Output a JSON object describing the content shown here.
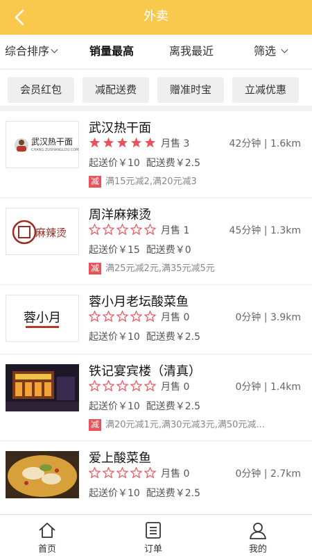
{
  "header": {
    "title": "外卖"
  },
  "sort": {
    "items": [
      {
        "label": "综合排序",
        "has_caret": true
      },
      {
        "label": "销量最高",
        "active": true
      },
      {
        "label": "离我最近"
      },
      {
        "label": "筛选",
        "has_caret": true
      }
    ]
  },
  "chips": [
    "会员红包",
    "减配送费",
    "赠准时宝",
    "立减优惠"
  ],
  "shops": [
    {
      "name": "武汉热干面",
      "rating": 5,
      "sales": "月售 3",
      "distance": "42分钟 | 1.6km",
      "min_price": "起送价￥10",
      "delivery_fee": "配送费￥2.5",
      "promo_badge": "减",
      "promo": "满15元减2,满20元减3",
      "logo_text": "武汉热干面",
      "logo_subtext": "CHANG ZUSHANGLOU.COM"
    },
    {
      "name": "周洋麻辣烫",
      "rating": 0,
      "sales": "月售 1",
      "distance": "45分钟 | 1.3km",
      "min_price": "起送价￥15",
      "delivery_fee": "配送费￥0",
      "promo_badge": "减",
      "promo": "满25元减2元,满35元减5元",
      "logo_text": "麻辣烫"
    },
    {
      "name": "蓉小月老坛酸菜鱼",
      "rating": 0,
      "sales": "月售 0",
      "distance": "0分钟 | 3.9km",
      "min_price": "起送价￥10",
      "delivery_fee": "配送费￥2.5",
      "logo_text": "蓉小月"
    },
    {
      "name": "铁记宴宾楼（清真）",
      "rating": 0,
      "sales": "月售 0",
      "distance": "0分钟 | 1.4km",
      "min_price": "起送价￥10",
      "delivery_fee": "配送费￥2.5",
      "promo_badge": "减",
      "promo": "满20元减1元,满30元减3元,满50元减..."
    },
    {
      "name": "爱上酸菜鱼",
      "rating": 0,
      "sales": "月售 0",
      "distance": "0分钟 | 2.7km",
      "min_price": "起送价￥10",
      "delivery_fee": "配送费￥2.5"
    }
  ],
  "tabbar": [
    {
      "label": "首页",
      "icon": "home-icon"
    },
    {
      "label": "订单",
      "icon": "order-list-icon"
    },
    {
      "label": "我的",
      "icon": "user-icon"
    }
  ],
  "colors": {
    "header": "#f9c94e",
    "star": "#e8545b",
    "promo_badge": "#e8545b"
  }
}
